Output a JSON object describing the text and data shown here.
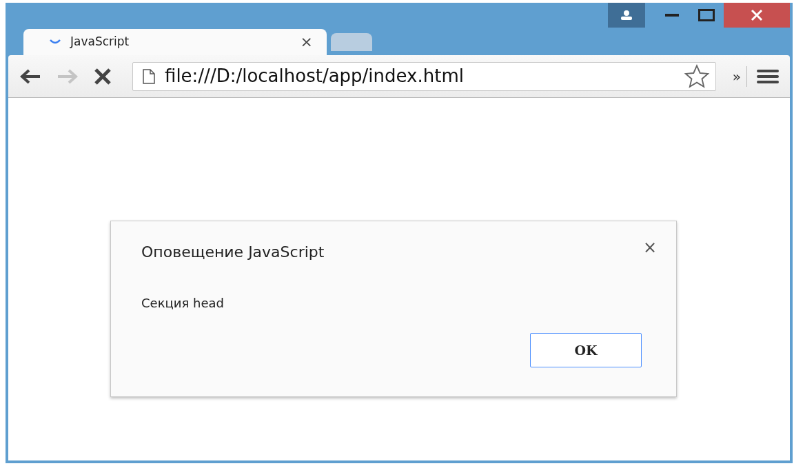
{
  "tabs": [
    {
      "title": "JavaScript",
      "close": "×",
      "selected": true
    },
    {
      "selected": false
    }
  ],
  "toolbar": {
    "back": {
      "disabled": false
    },
    "forward": {
      "disabled": true
    },
    "address": "file:///D:/localhost/app/index.html",
    "bookmarked": false,
    "overflow": "»"
  },
  "dialog": {
    "title": "Оповещение JavaScript",
    "close": "×",
    "message": "Секция head",
    "button": "OK"
  }
}
